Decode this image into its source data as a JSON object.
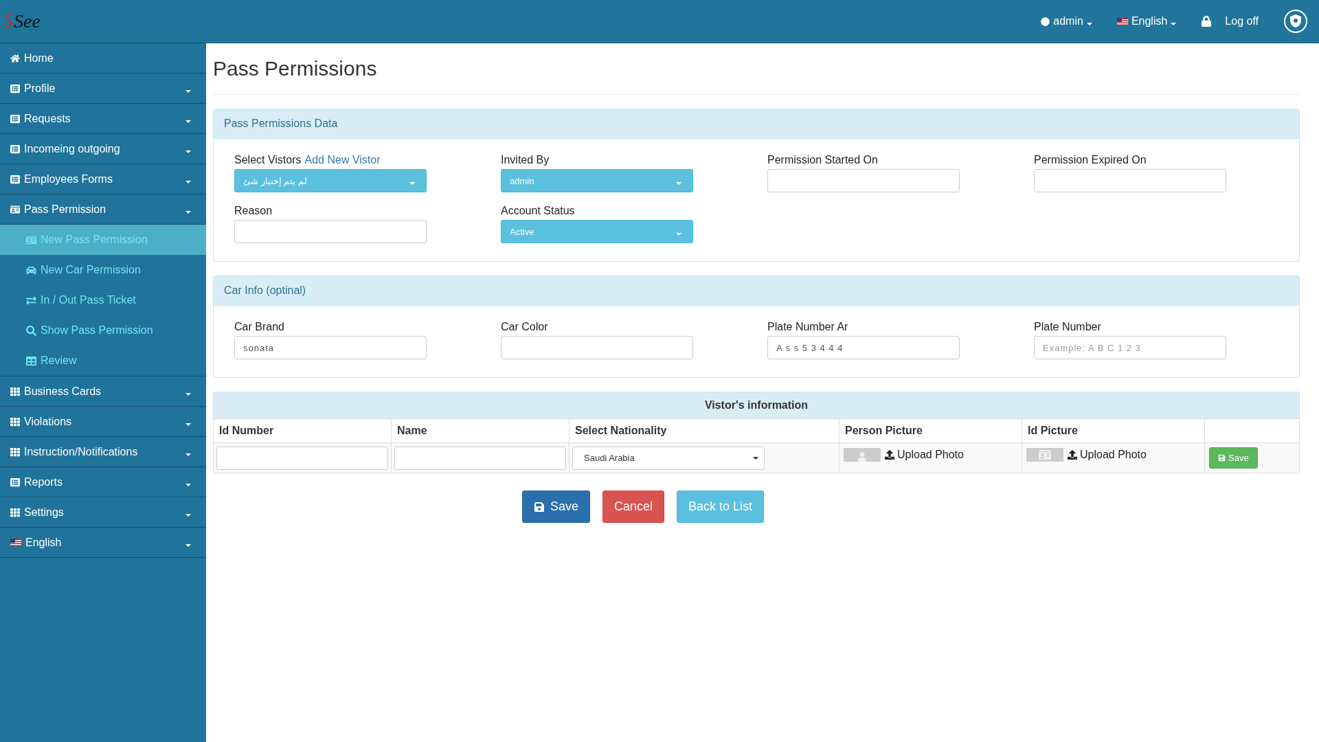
{
  "header": {
    "logo": "See",
    "user": "admin",
    "language": "English",
    "logout": "Log off"
  },
  "sidebar": {
    "items": [
      {
        "label": "Home",
        "kind": "link"
      },
      {
        "label": "Profile",
        "kind": "menu"
      },
      {
        "label": "Requests",
        "kind": "menu"
      },
      {
        "label": "Incomeing outgoing",
        "kind": "menu"
      },
      {
        "label": "Employees Forms",
        "kind": "menu"
      },
      {
        "label": "Pass Permission",
        "kind": "menu",
        "expanded": true,
        "children": [
          {
            "label": "New Pass Permission",
            "selected": true
          },
          {
            "label": "New Car Permission",
            "selected": false
          },
          {
            "label": "In / Out Pass Ticket",
            "selected": false
          },
          {
            "label": "Show Pass Permission",
            "selected": false
          },
          {
            "label": "Review",
            "selected": false
          }
        ]
      },
      {
        "label": "Business Cards",
        "kind": "menu"
      },
      {
        "label": "Violations",
        "kind": "menu"
      },
      {
        "label": "Instruction/Notifications",
        "kind": "menu"
      },
      {
        "label": "Reports",
        "kind": "menu"
      },
      {
        "label": "Settings",
        "kind": "menu"
      },
      {
        "label": "English",
        "kind": "menu"
      }
    ]
  },
  "page_title": "Pass Permissions",
  "panels": [
    {
      "title": "Pass Permissions Data",
      "fields": [
        {
          "kind": "select",
          "label": "Select Vistors",
          "link": "Add New Vistor",
          "value": "لم يتم إختيار شئ"
        },
        {
          "kind": "select",
          "label": "Invited By",
          "value": "admin"
        },
        {
          "kind": "input",
          "label": "Permission Started On"
        },
        {
          "kind": "input",
          "label": "Permission Expired On"
        },
        {
          "kind": "input",
          "label": "Reason"
        },
        {
          "kind": "select",
          "label": "Account Status",
          "value": "Active"
        }
      ]
    },
    {
      "title": "Car Info (optinal)",
      "fields": [
        {
          "kind": "input",
          "label": "Car Brand",
          "value": "sonata"
        },
        {
          "kind": "input",
          "label": "Car Color"
        },
        {
          "kind": "input",
          "label": "Plate Number Ar",
          "value": "A s s 5 3 4 4 4"
        },
        {
          "kind": "input",
          "label": "Plate Number",
          "placeholder": "Example: A B C 1 2 3"
        }
      ]
    }
  ],
  "visitors_table": {
    "title": "Vistor's information",
    "columns": [
      "Id Number",
      "Name",
      "Select Nationality",
      "Person Picture",
      "Id Picture"
    ],
    "row": {
      "nationality": "Saudi Arabia",
      "person_upload": "Upload Photo",
      "id_upload": "Upload Photo",
      "save": "Save"
    }
  },
  "buttons": [
    {
      "kind": "primary",
      "label": "Save"
    },
    {
      "kind": "danger",
      "label": "Cancel"
    },
    {
      "kind": "info",
      "label": "Back to List"
    }
  ]
}
